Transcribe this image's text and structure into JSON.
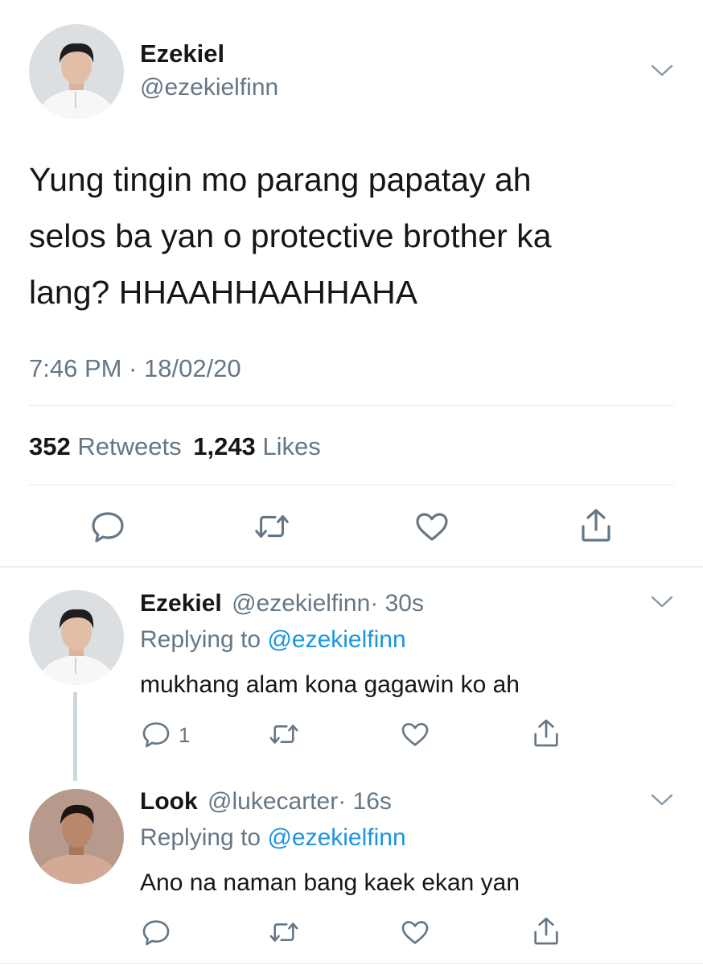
{
  "main_tweet": {
    "display_name": "Ezekiel",
    "handle": "@ezekielfinn",
    "text_lines": [
      "Yung tingin mo parang papatay ah",
      "selos ba yan o protective brother ka",
      "lang? HHAAHHAAHHAHA"
    ],
    "timestamp": "7:46 PM · 18/02/20",
    "retweet_count": "352",
    "retweets_label": "Retweets",
    "like_count": "1,243",
    "likes_label": "Likes"
  },
  "replies": [
    {
      "display_name": "Ezekiel",
      "handle": "@ezekielfinn",
      "time": "· 30s",
      "replying_prefix": "Replying to",
      "replying_to": "@ezekielfinn",
      "text": "mukhang alam kona gagawin ko ah",
      "reply_count": "1"
    },
    {
      "display_name": "Look",
      "handle": "@lukecarter",
      "time": "· 16s",
      "replying_prefix": "Replying to",
      "replying_to": "@ezekielfinn",
      "text": "Ano na naman bang kaek ekan yan",
      "reply_count": ""
    }
  ],
  "icons": [
    "reply-icon",
    "retweet-icon",
    "like-icon",
    "share-icon",
    "chevron-down-icon"
  ],
  "colors": {
    "text": "#14171a",
    "muted": "#657786",
    "link": "#1b95e0",
    "icon": "#657786",
    "divider": "#e1e8ed"
  }
}
